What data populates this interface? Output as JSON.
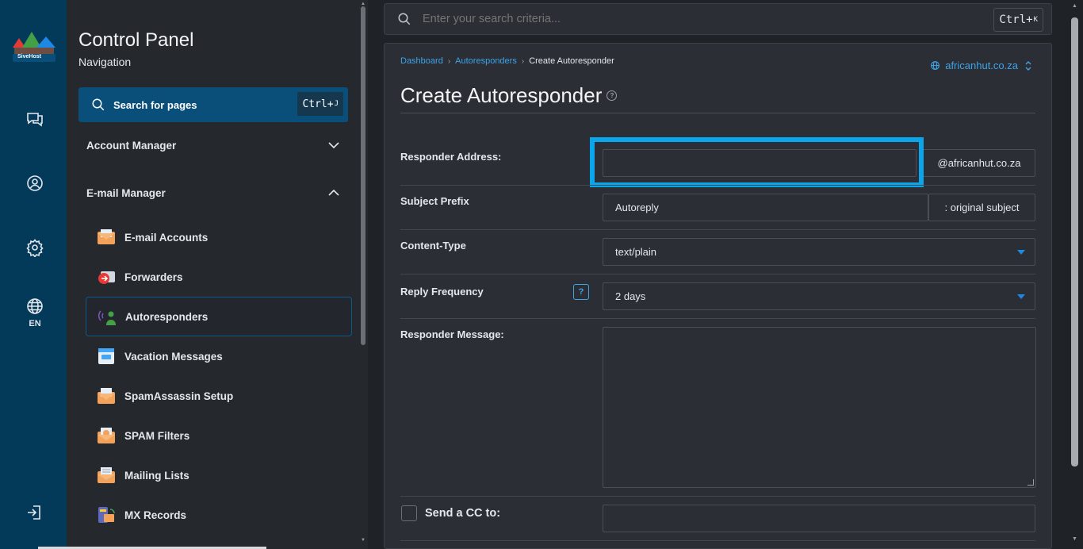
{
  "rail": {
    "logo_text": "SiveHost",
    "lang": "EN",
    "icons": [
      "chat-icon",
      "user-icon",
      "gear-icon",
      "globe-icon",
      "logout-icon"
    ]
  },
  "nav": {
    "title": "Control Panel",
    "subtitle": "Navigation",
    "search_label": "Search for pages",
    "search_kbd": "Ctrl+",
    "search_kbd_key": "J",
    "sections": [
      {
        "label": "Account Manager",
        "expanded": false
      },
      {
        "label": "E-mail Manager",
        "expanded": true
      }
    ],
    "items": [
      {
        "label": "E-mail Accounts",
        "icon": "email-accounts-icon"
      },
      {
        "label": "Forwarders",
        "icon": "forwarders-icon"
      },
      {
        "label": "Autoresponders",
        "icon": "autoresponders-icon",
        "active": true
      },
      {
        "label": "Vacation Messages",
        "icon": "vacation-messages-icon"
      },
      {
        "label": "SpamAssassin Setup",
        "icon": "spamassassin-icon"
      },
      {
        "label": "SPAM Filters",
        "icon": "spam-filters-icon"
      },
      {
        "label": "Mailing Lists",
        "icon": "mailing-lists-icon"
      },
      {
        "label": "MX Records",
        "icon": "mx-records-icon"
      }
    ]
  },
  "top_search": {
    "placeholder": "Enter your search criteria...",
    "kbd": "Ctrl+",
    "kbd_key": "K"
  },
  "breadcrumb": {
    "items": [
      "Dashboard",
      "Autoresponders"
    ],
    "current": "Create Autoresponder"
  },
  "domain_selector": "africanhut.co.za",
  "page_title": "Create Autoresponder",
  "form": {
    "responder_address_label": "Responder Address:",
    "responder_address_value": "",
    "responder_address_suffix": "@africanhut.co.za",
    "subject_prefix_label": "Subject Prefix",
    "subject_prefix_value": "Autoreply",
    "subject_prefix_suffix": ": original subject",
    "content_type_label": "Content-Type",
    "content_type_value": "text/plain",
    "reply_frequency_label": "Reply Frequency",
    "reply_frequency_help": "?",
    "reply_frequency_value": "2 days",
    "responder_message_label": "Responder Message:",
    "responder_message_value": "",
    "send_cc_label": "Send a CC to:",
    "send_cc_value": ""
  },
  "colors": {
    "accent": "#3fa3e6",
    "highlight": "#0ba5ec",
    "rail_bg": "#033a5a",
    "search_bg": "#0a4f7a"
  }
}
